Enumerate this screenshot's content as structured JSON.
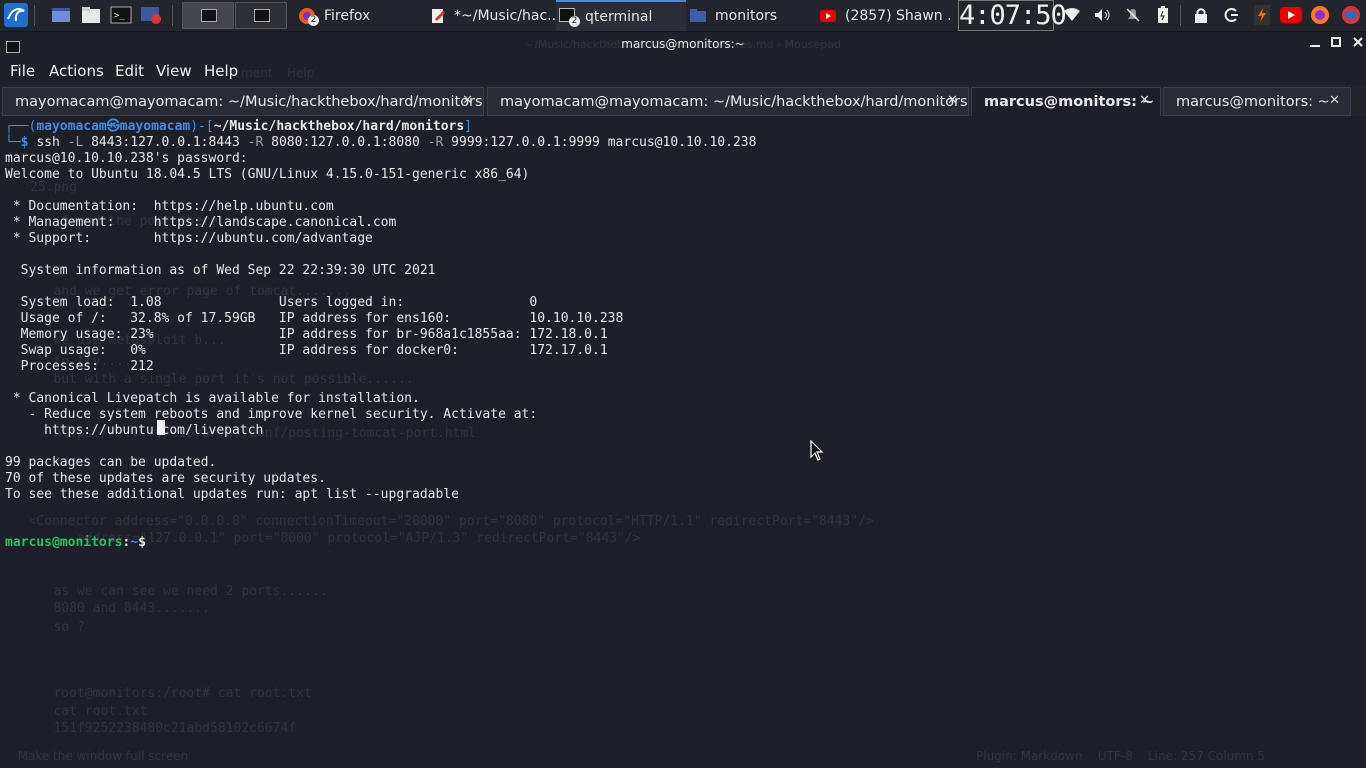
{
  "taskbar": {
    "tasks": [
      {
        "label": "Firefox",
        "badge": "2"
      },
      {
        "label": "*~/Music/hac..."
      },
      {
        "label": "qterminal",
        "badge": "2"
      },
      {
        "label": "monitors"
      },
      {
        "label": "(2857) Shawn ..."
      }
    ],
    "clock": "4:07:50"
  },
  "window": {
    "title": "marcus@monitors:~",
    "ghost_title": "~/Music/hackthebox/hard/monitors/notes.md - Mousepad"
  },
  "menubar": {
    "items": [
      "File",
      "Actions",
      "Edit",
      "View",
      "Help"
    ],
    "ghost_items": [
      "ment",
      "Help"
    ]
  },
  "tabs": [
    {
      "label": "mayomacam@mayomacam: ~/Music/hackthebox/hard/monitors",
      "active": false
    },
    {
      "label": "mayomacam@mayomacam: ~/Music/hackthebox/hard/monitors",
      "active": false
    },
    {
      "label": "marcus@monitors: ~",
      "active": true
    },
    {
      "label": "marcus@monitors: ~",
      "active": false
    }
  ],
  "terminal": {
    "prompt1": {
      "user": "mayomacam",
      "host": "mayomacam",
      "cwd": "~/Music/hackthebox/hard/monitors",
      "cmd": "ssh",
      "args": [
        {
          "flag": "-L",
          "value": "8443:127.0.0.1:8443"
        },
        {
          "flag": "-R",
          "value": "8080:127.0.0.1:8080"
        },
        {
          "flag": "-R",
          "value": "9999:127.0.0.1:9999"
        }
      ],
      "target": "marcus@10.10.10.238"
    },
    "output": [
      "marcus@10.10.10.238's password:",
      "Welcome to Ubuntu 18.04.5 LTS (GNU/Linux 4.15.0-151-generic x86_64)",
      "",
      " * Documentation:  https://help.ubuntu.com",
      " * Management:     https://landscape.canonical.com",
      " * Support:        https://ubuntu.com/advantage",
      "",
      "  System information as of Wed Sep 22 22:39:30 UTC 2021",
      "",
      "  System load:  1.08               Users logged in:                0",
      "  Usage of /:   32.8% of 17.59GB   IP address for ens160:          10.10.10.238",
      "  Memory usage: 23%                IP address for br-968a1c1855aa: 172.18.0.1",
      "  Swap usage:   0%                 IP address for docker0:         172.17.0.1",
      "  Processes:    212",
      "",
      " * Canonical Livepatch is available for installation.",
      "   - Reduce system reboots and improve kernel security. Activate at:",
      "     https://ubuntu.com/livepatch",
      "",
      "99 packages can be updated.",
      "70 of these updates are security updates.",
      "To see these additional updates run: apt list --upgradable"
    ],
    "prompt2": {
      "userhost": "marcus@monitors",
      "path": "~",
      "symbol": "$"
    }
  },
  "ghost_text": [
    "25.png",
    "    found the port there........",
    "   and we get error page of tomcat.......",
    "   we use metasploit b...",
    "   to try.......",
    "   but with a single port it's not possible......",
    "   https://....ry/libraries/conf/posting-tomcat-port.html",
    "   <Connector address=\"0.0.0.0\" connectionTimeout=\"20000\" port=\"8080\" protocol=\"HTTP/1.1\" redirectPort=\"8443\"/>",
    "   ...address=\"127.0.0.1\" port=\"8000\" protocol=\"AJP/1.3\" redirectPort=\"8443\"/>",
    "   as we can see we need 2 ports......",
    "   8080 and 8443.......",
    "   so ?",
    "   root@monitors:/root# cat root.txt",
    "   cat root.txt",
    "   151f9252238480c21abd58102c6674f",
    "  Make the window full screen",
    "Plugin: Markdown    UTF-8    Line: 257 Column 5"
  ]
}
